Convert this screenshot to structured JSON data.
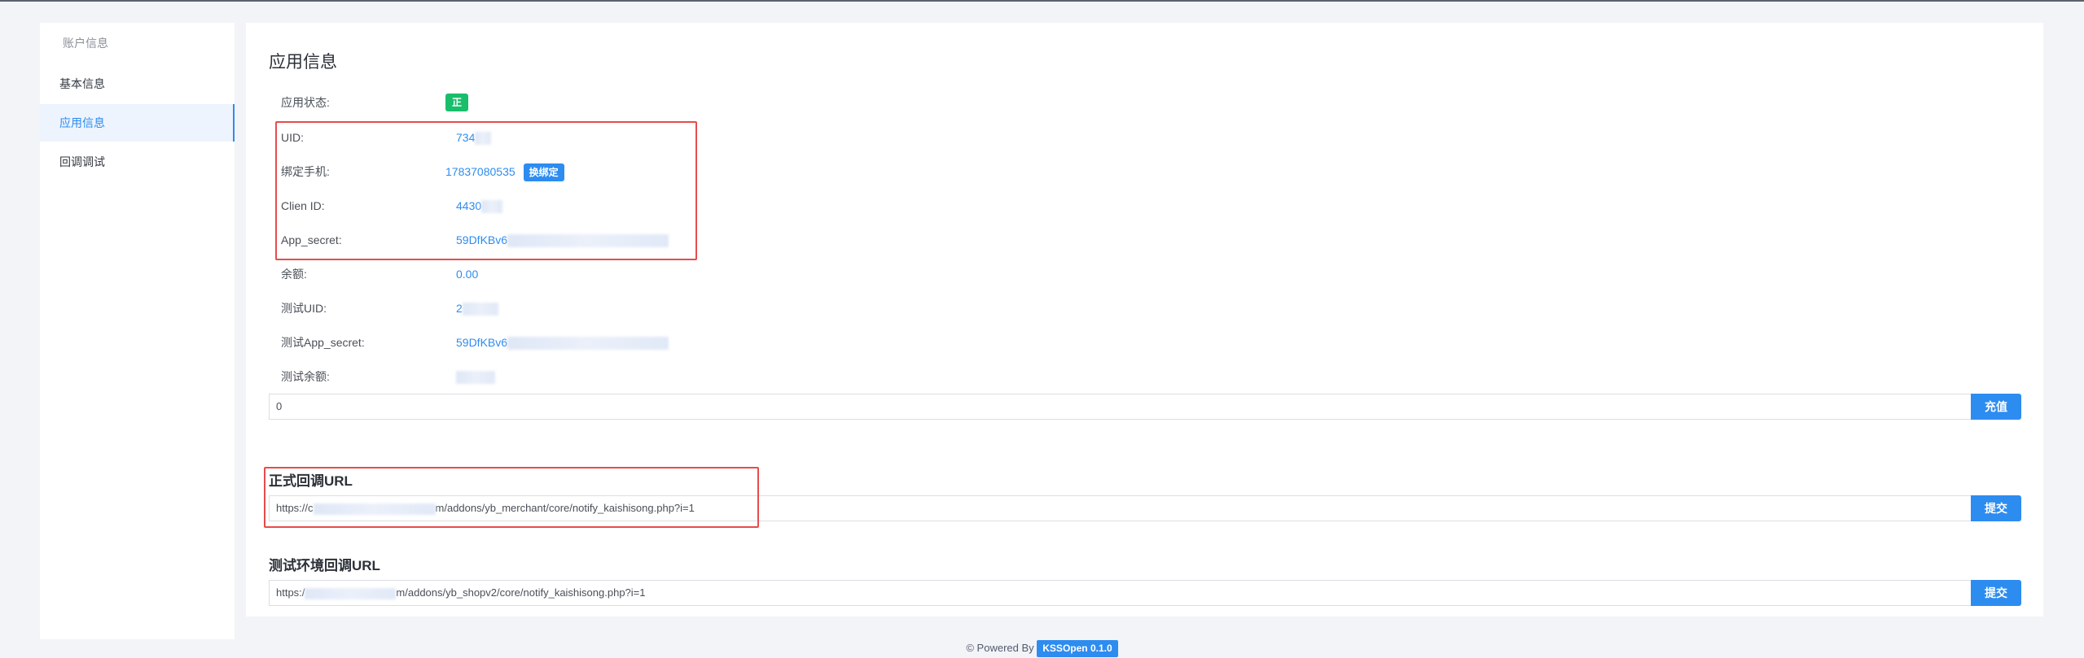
{
  "sidebar": {
    "section_title": "账户信息",
    "items": [
      {
        "label": "基本信息"
      },
      {
        "label": "应用信息"
      },
      {
        "label": "回调调试"
      }
    ]
  },
  "main": {
    "title": "应用信息",
    "fields": {
      "status": {
        "label": "应用状态:",
        "value": "正常"
      },
      "uid": {
        "label": "UID:",
        "value": "734"
      },
      "phone": {
        "label": "绑定手机:",
        "value": "17837080535",
        "action": "换绑定"
      },
      "client_id": {
        "label": "Clien ID:",
        "value": "4430"
      },
      "app_secret": {
        "label": "App_secret:",
        "value": "59DfKBv6"
      },
      "balance": {
        "label": "余额:",
        "value": "0.00"
      },
      "test_uid": {
        "label": "测试UID:",
        "value": "2"
      },
      "test_app_secret": {
        "label": "测试App_secret:",
        "value": "59DfKBv6"
      },
      "test_balance": {
        "label": "测试余额:",
        "value": ""
      }
    },
    "recharge": {
      "value": "0",
      "button": "充值"
    },
    "prod_callback": {
      "title": "正式回调URL",
      "prefix": "https://c",
      "suffix": "m/addons/yb_merchant/core/notify_kaishisong.php?i=1",
      "button": "提交"
    },
    "test_callback": {
      "title": "测试环境回调URL",
      "prefix": "https:/",
      "suffix": "m/addons/yb_shopv2/core/notify_kaishisong.php?i=1",
      "button": "提交"
    }
  },
  "footer": {
    "text": "© Powered By",
    "version": "KSSOpen 0.1.0"
  },
  "colors": {
    "primary": "#2d8cf0",
    "success": "#19be6b",
    "highlight": "#e74c4c"
  }
}
